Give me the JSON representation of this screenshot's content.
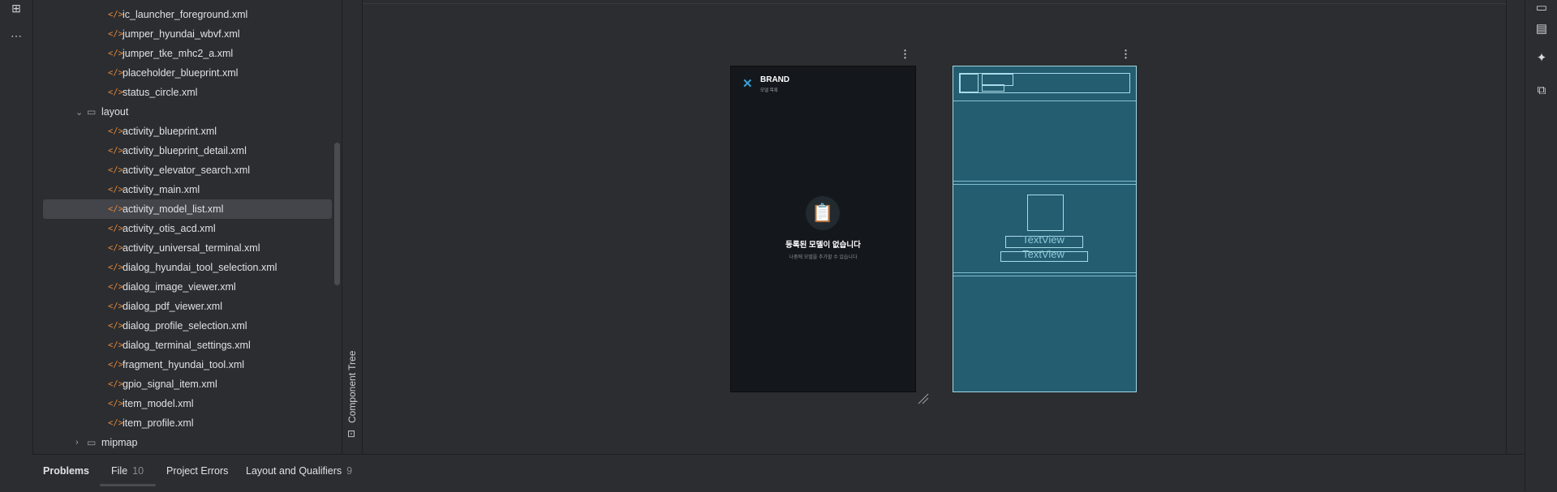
{
  "project_tree": {
    "items": [
      {
        "label": "ic_launcher_foreground.xml",
        "type": "file"
      },
      {
        "label": "jumper_hyundai_wbvf.xml",
        "type": "file"
      },
      {
        "label": "jumper_tke_mhc2_a.xml",
        "type": "file"
      },
      {
        "label": "placeholder_blueprint.xml",
        "type": "file"
      },
      {
        "label": "status_circle.xml",
        "type": "file"
      },
      {
        "label": "layout",
        "type": "folder-open"
      },
      {
        "label": "activity_blueprint.xml",
        "type": "file"
      },
      {
        "label": "activity_blueprint_detail.xml",
        "type": "file"
      },
      {
        "label": "activity_elevator_search.xml",
        "type": "file"
      },
      {
        "label": "activity_main.xml",
        "type": "file"
      },
      {
        "label": "activity_model_list.xml",
        "type": "file",
        "selected": true
      },
      {
        "label": "activity_otis_acd.xml",
        "type": "file"
      },
      {
        "label": "activity_universal_terminal.xml",
        "type": "file"
      },
      {
        "label": "dialog_hyundai_tool_selection.xml",
        "type": "file"
      },
      {
        "label": "dialog_image_viewer.xml",
        "type": "file"
      },
      {
        "label": "dialog_pdf_viewer.xml",
        "type": "file"
      },
      {
        "label": "dialog_profile_selection.xml",
        "type": "file"
      },
      {
        "label": "dialog_terminal_settings.xml",
        "type": "file"
      },
      {
        "label": "fragment_hyundai_tool.xml",
        "type": "file"
      },
      {
        "label": "gpio_signal_item.xml",
        "type": "file"
      },
      {
        "label": "item_model.xml",
        "type": "file"
      },
      {
        "label": "item_profile.xml",
        "type": "file"
      },
      {
        "label": "mipmap",
        "type": "folder-closed"
      }
    ]
  },
  "component_tree": {
    "label": "Component Tree"
  },
  "design_preview": {
    "brand": "BRAND",
    "subtitle": "모델 목록",
    "empty_title": "등록된 모델이 없습니다",
    "empty_desc": "나중에 모델을 추가할 수 있습니다"
  },
  "blueprint": {
    "textview_1": "TextView",
    "textview_2": "TextView"
  },
  "bottom_tabs": [
    {
      "label": "Problems",
      "count": ""
    },
    {
      "label": "File",
      "count": "10"
    },
    {
      "label": "Project Errors",
      "count": ""
    },
    {
      "label": "Layout and Qualifiers",
      "count": "9"
    }
  ],
  "colors": {
    "background": "#2b2d30",
    "xml_icon": "#e0873c",
    "selected_row": "#43454a",
    "blueprint": "#245c70",
    "accent_close": "#3a9fd6"
  }
}
